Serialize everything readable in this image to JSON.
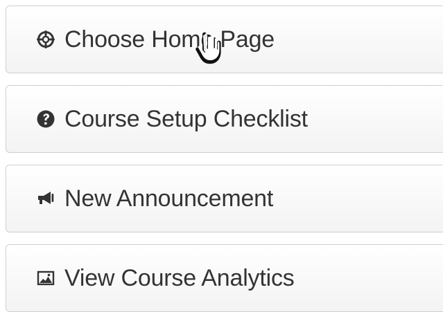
{
  "buttons": [
    {
      "label": "Choose Home Page",
      "icon": "target-icon"
    },
    {
      "label": "Course Setup Checklist",
      "icon": "question-circle-icon"
    },
    {
      "label": "New Announcement",
      "icon": "megaphone-icon"
    },
    {
      "label": "View Course Analytics",
      "icon": "image-chart-icon"
    }
  ],
  "cursor": {
    "icon": "hand-pointer-icon"
  }
}
